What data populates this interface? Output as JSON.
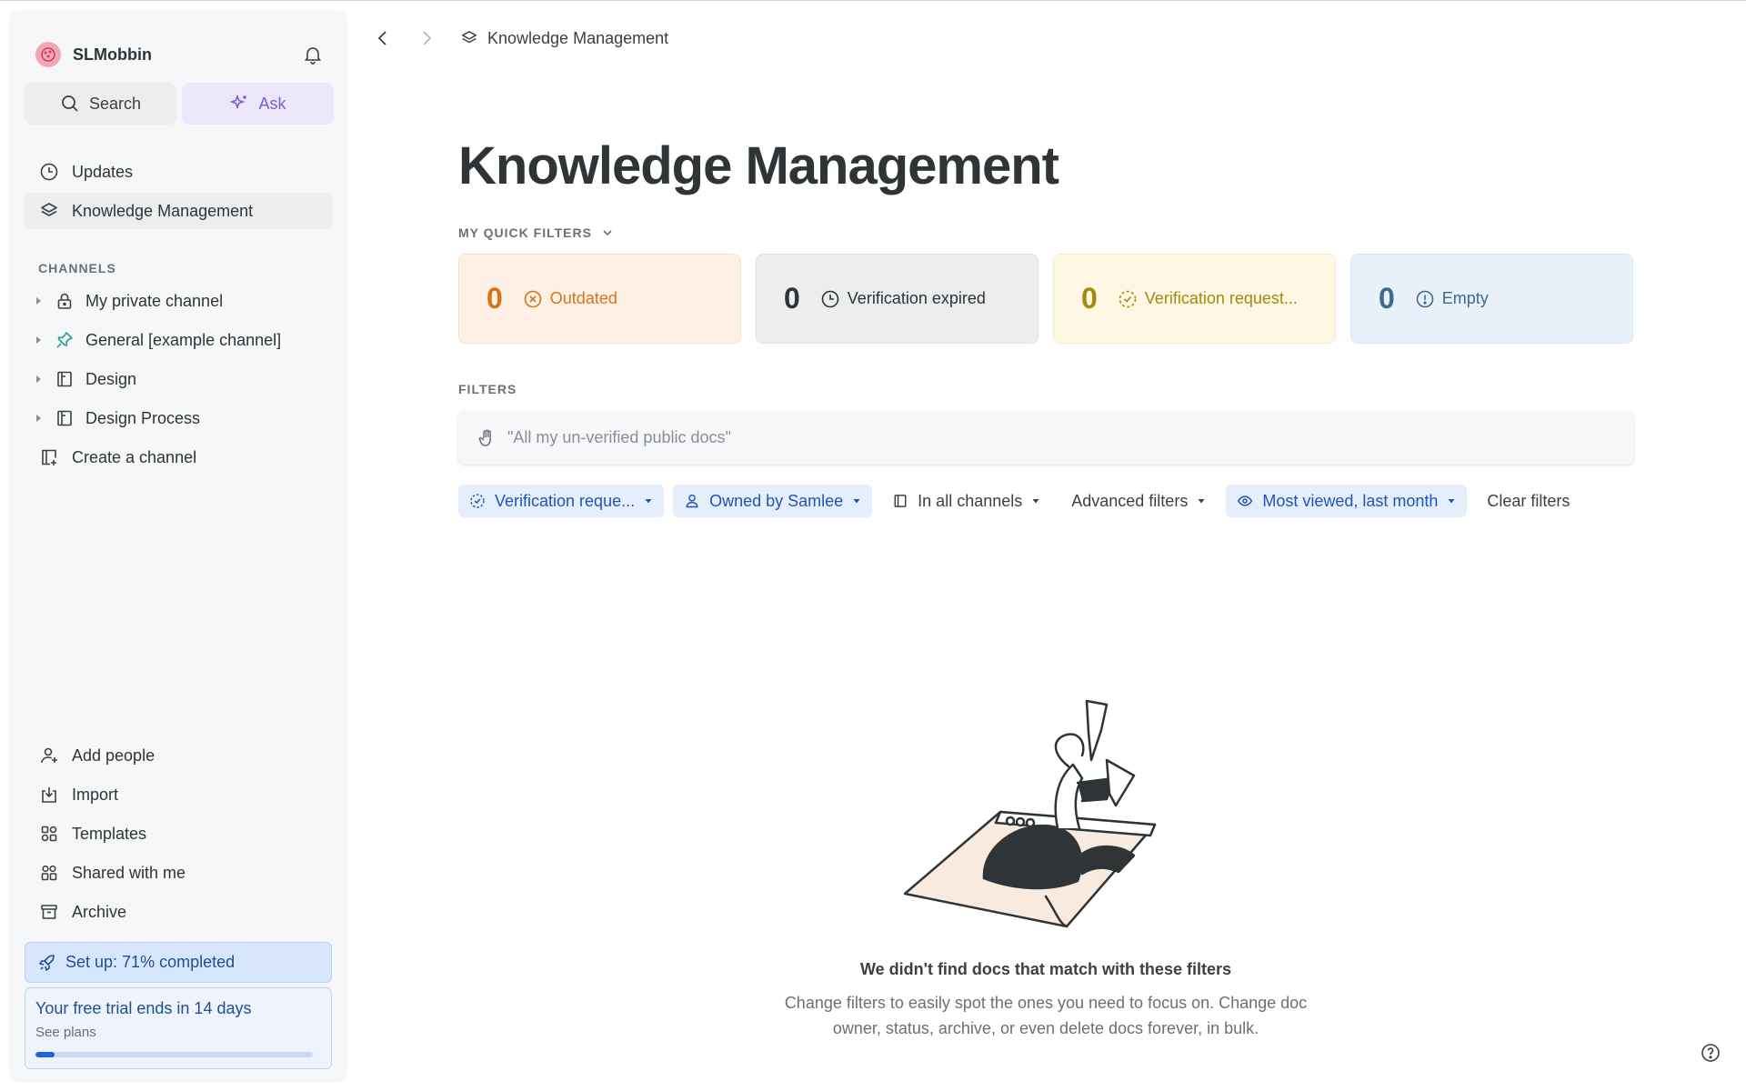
{
  "workspace": {
    "name": "SLMobbin"
  },
  "sidebar": {
    "search_label": "Search",
    "ask_label": "Ask",
    "nav": [
      {
        "label": "Updates",
        "icon": "clock-icon"
      },
      {
        "label": "Knowledge Management",
        "icon": "layers-icon",
        "active": true
      }
    ],
    "channels_title": "CHANNELS",
    "channels": [
      {
        "label": "My private channel",
        "icon": "lock-icon"
      },
      {
        "label": "General [example channel]",
        "icon": "pin-icon"
      },
      {
        "label": "Design",
        "icon": "channel-icon"
      },
      {
        "label": "Design Process",
        "icon": "channel-icon"
      }
    ],
    "create_channel": "Create a channel",
    "bottom": [
      {
        "label": "Add people",
        "icon": "add-user-icon"
      },
      {
        "label": "Import",
        "icon": "import-icon"
      },
      {
        "label": "Templates",
        "icon": "templates-icon"
      },
      {
        "label": "Shared with me",
        "icon": "shared-icon"
      },
      {
        "label": "Archive",
        "icon": "archive-icon"
      }
    ],
    "setup_label": "Set up: 71% completed",
    "trial_title": "Your free trial ends in 14 days",
    "trial_sub": "See plans",
    "trial_progress": 0.07
  },
  "breadcrumb": {
    "label": "Knowledge Management"
  },
  "main": {
    "title": "Knowledge Management",
    "quick_filters_label": "MY QUICK FILTERS",
    "quick_filters": [
      {
        "count": "0",
        "label": "Outdated",
        "icon": "x-circle-icon"
      },
      {
        "count": "0",
        "label": "Verification expired",
        "icon": "clock-icon"
      },
      {
        "count": "0",
        "label": "Verification request...",
        "icon": "dashed-check-icon"
      },
      {
        "count": "0",
        "label": "Empty",
        "icon": "alert-circle-icon"
      }
    ],
    "filters_label": "FILTERS",
    "filter_placeholder": "\"All my un-verified public docs\"",
    "chips": [
      {
        "label": "Verification reque...",
        "active": true
      },
      {
        "label": "Owned by Samlee",
        "active": true
      },
      {
        "label": "In all channels",
        "active": false
      },
      {
        "label": "Advanced filters",
        "active": false
      },
      {
        "label": "Most viewed, last month",
        "active": true
      }
    ],
    "clear_filters": "Clear filters",
    "empty_title": "We didn't find docs that match with these filters",
    "empty_desc": "Change filters to easily spot the ones you need to focus on. Change doc owner, status, archive, or even delete docs forever, in bulk."
  },
  "colors": {
    "accent": "#1d56b8",
    "ask": "#7a5cd6",
    "outdated": "#d4741c",
    "request": "#a48a0c",
    "empty": "#3d6b8e"
  }
}
